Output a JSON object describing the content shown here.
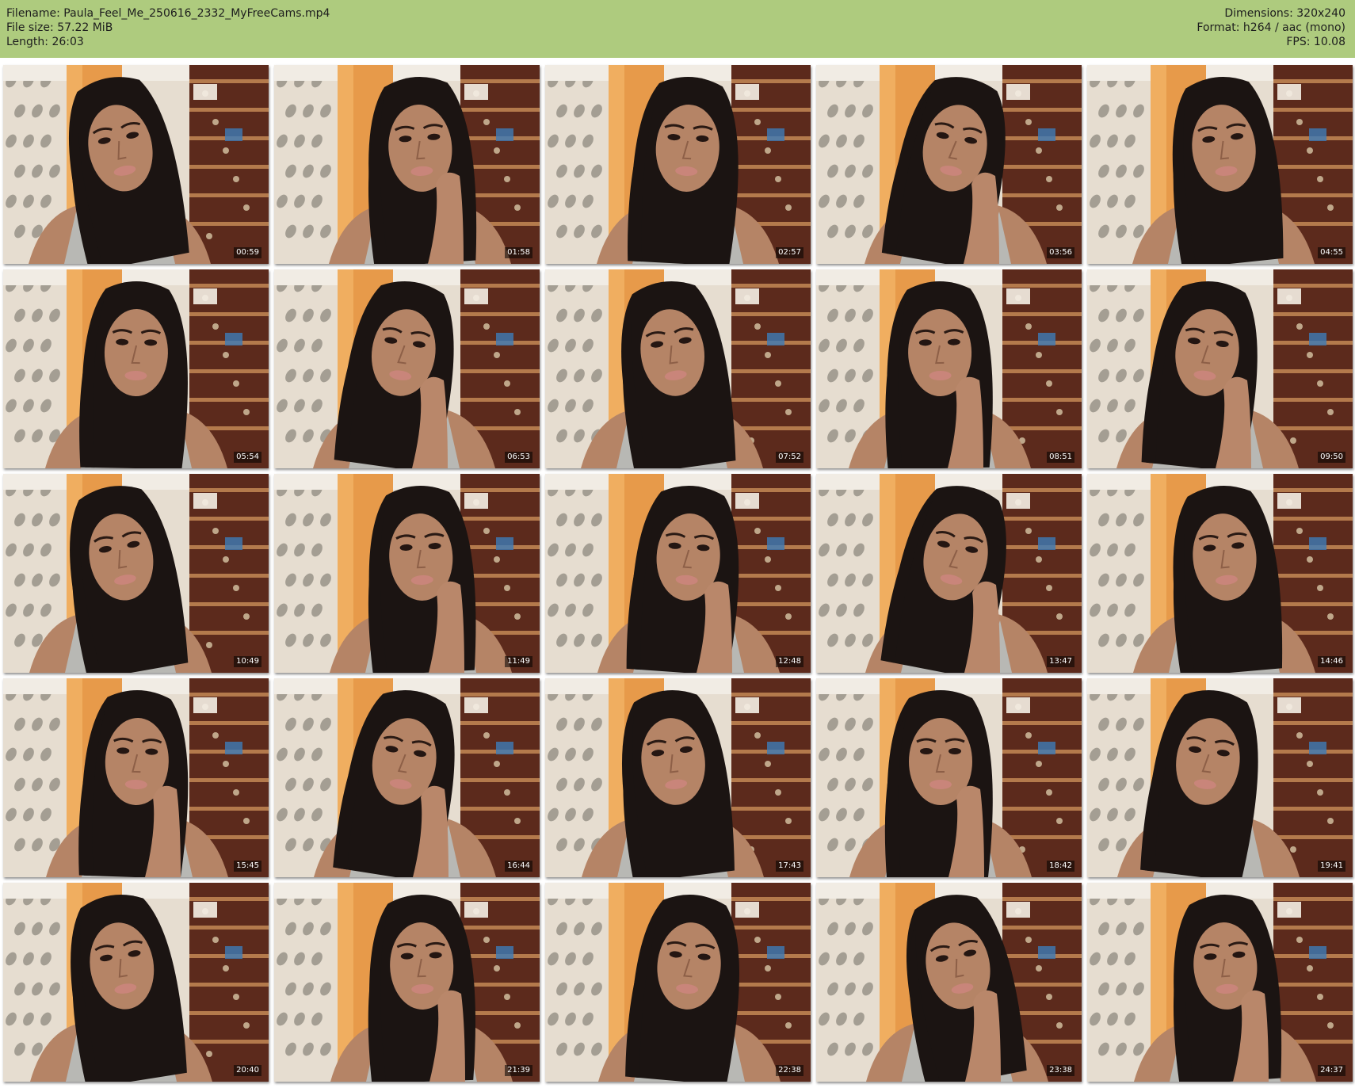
{
  "header": {
    "filename": "Filename: Paula_Feel_Me_250616_2332_MyFreeCams.mp4",
    "filesize": "File size: 57.22 MiB",
    "length": "Length: 26:03",
    "dimensions": "Dimensions: 320x240",
    "format": "Format: h264 / aac (mono)",
    "fps": "FPS: 10.08"
  },
  "thumbnails": [
    {
      "timestamp": "00:59"
    },
    {
      "timestamp": "01:58"
    },
    {
      "timestamp": "02:57"
    },
    {
      "timestamp": "03:56"
    },
    {
      "timestamp": "04:55"
    },
    {
      "timestamp": "05:54"
    },
    {
      "timestamp": "06:53"
    },
    {
      "timestamp": "07:52"
    },
    {
      "timestamp": "08:51"
    },
    {
      "timestamp": "09:50"
    },
    {
      "timestamp": "10:49"
    },
    {
      "timestamp": "11:49"
    },
    {
      "timestamp": "12:48"
    },
    {
      "timestamp": "13:47"
    },
    {
      "timestamp": "14:46"
    },
    {
      "timestamp": "15:45"
    },
    {
      "timestamp": "16:44"
    },
    {
      "timestamp": "17:43"
    },
    {
      "timestamp": "18:42"
    },
    {
      "timestamp": "19:41"
    },
    {
      "timestamp": "20:40"
    },
    {
      "timestamp": "21:39"
    },
    {
      "timestamp": "22:38"
    },
    {
      "timestamp": "23:38"
    },
    {
      "timestamp": "24:37"
    }
  ],
  "colors": {
    "header_bg": "#aecb7e",
    "wallpaper": "#e6ddd0",
    "door": "#e79a4a",
    "shelf": "#5c2a1c",
    "hair": "#1b1412",
    "skin": "#b58466",
    "top": "#b8b8b4"
  }
}
